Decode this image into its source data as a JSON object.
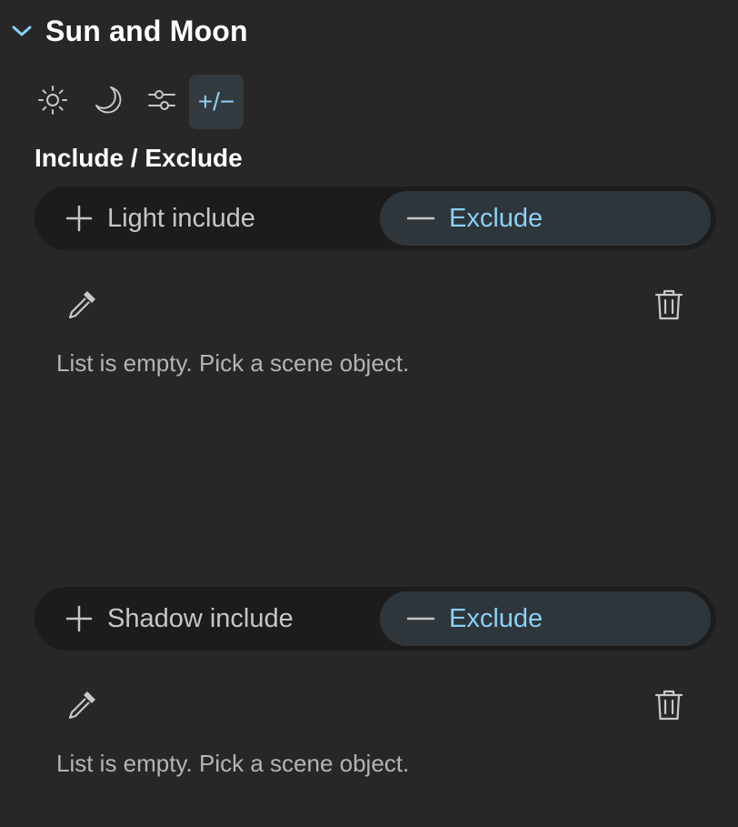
{
  "panel": {
    "title": "Sun and Moon",
    "tabs": [
      {
        "icon": "sun-icon",
        "label": ""
      },
      {
        "icon": "moon-icon",
        "label": ""
      },
      {
        "icon": "sliders-icon",
        "label": ""
      },
      {
        "icon": "include-exclude-icon",
        "label": "+/−",
        "active": true
      }
    ],
    "section_title": "Include / Exclude"
  },
  "light": {
    "include_label": "Light include",
    "exclude_label": "Exclude",
    "selected": "Exclude",
    "empty_text": "List is empty. Pick a scene object."
  },
  "shadow": {
    "include_label": "Shadow include",
    "exclude_label": "Exclude",
    "selected": "Exclude",
    "empty_text": "List is empty. Pick a scene object."
  },
  "colors": {
    "background": "#272727",
    "accent": "#8ad0f5",
    "segment_track": "#1c1c1c",
    "segment_active": "#2e353b"
  }
}
